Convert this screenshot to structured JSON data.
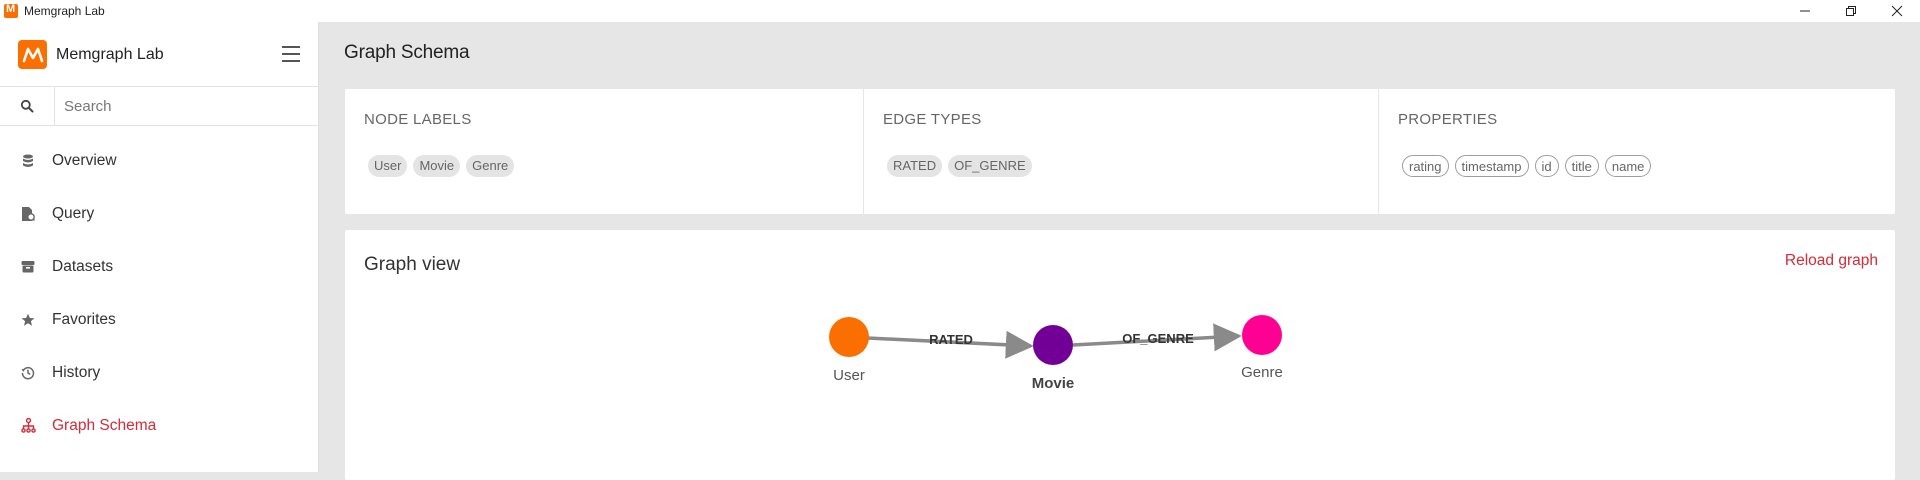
{
  "window": {
    "title": "Memgraph Lab"
  },
  "sidebar": {
    "brand": "Memgraph Lab",
    "search_placeholder": "Search",
    "items": [
      {
        "label": "Overview",
        "icon": "database-icon",
        "active": false
      },
      {
        "label": "Query",
        "icon": "query-file-icon",
        "active": false
      },
      {
        "label": "Datasets",
        "icon": "box-icon",
        "active": false
      },
      {
        "label": "Favorites",
        "icon": "star-icon",
        "active": false
      },
      {
        "label": "History",
        "icon": "history-icon",
        "active": false
      },
      {
        "label": "Graph Schema",
        "icon": "schema-tree-icon",
        "active": true
      }
    ]
  },
  "main": {
    "page_title": "Graph Schema",
    "node_labels": {
      "title": "NODE LABELS",
      "items": [
        "User",
        "Movie",
        "Genre"
      ]
    },
    "edge_types": {
      "title": "EDGE TYPES",
      "items": [
        "RATED",
        "OF_GENRE"
      ]
    },
    "properties": {
      "title": "PROPERTIES",
      "items": [
        "rating",
        "timestamp",
        "id",
        "title",
        "name"
      ]
    },
    "graph_view": {
      "title": "Graph view",
      "reload_label": "Reload graph",
      "nodes": [
        {
          "label": "User",
          "color": "#fb6e00",
          "bold": false
        },
        {
          "label": "Movie",
          "color": "#720096",
          "bold": true
        },
        {
          "label": "Genre",
          "color": "#ff0092",
          "bold": false
        }
      ],
      "edges": [
        {
          "label": "RATED",
          "from": "User",
          "to": "Movie"
        },
        {
          "label": "OF_GENRE",
          "from": "Movie",
          "to": "Genre"
        }
      ]
    }
  },
  "colors": {
    "accent": "#d52a38",
    "brand": "#fb6e00"
  }
}
